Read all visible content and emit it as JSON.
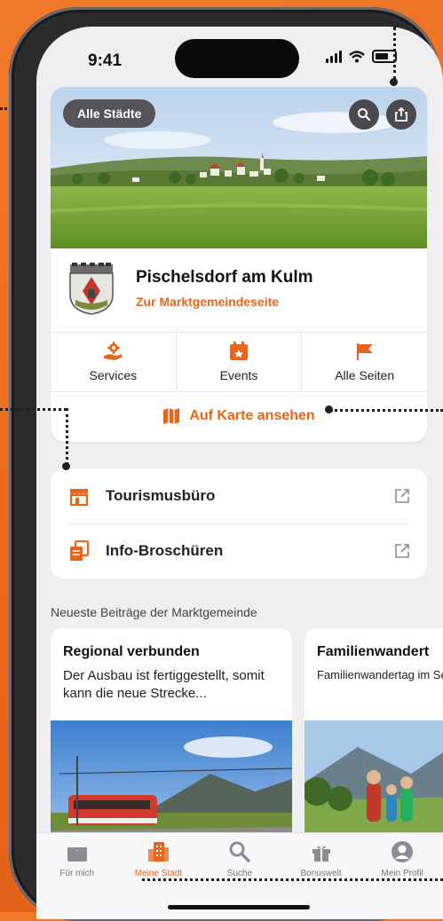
{
  "status_bar": {
    "time": "9:41"
  },
  "header": {
    "all_cities_label": "Alle Städte"
  },
  "town": {
    "name": "Pischelsdorf am Kulm",
    "link_label": "Zur Marktgemeindeseite"
  },
  "quick_actions": [
    {
      "label": "Services",
      "icon": "gear-hand-icon"
    },
    {
      "label": "Events",
      "icon": "calendar-star-icon"
    },
    {
      "label": "Alle Seiten",
      "icon": "flag-icon"
    }
  ],
  "map_link": {
    "label": "Auf Karte ansehen",
    "icon": "map-icon"
  },
  "links": [
    {
      "label": "Tourismusbüro",
      "icon": "storefront-icon"
    },
    {
      "label": "Info-Broschüren",
      "icon": "documents-icon"
    }
  ],
  "posts_section": {
    "title": "Neueste Beiträge der Marktgemeinde"
  },
  "posts": [
    {
      "title": "Regional verbunden",
      "teaser": "Der Ausbau ist fertiggestellt, somit kann die neue Strecke..."
    },
    {
      "title": "Familienwandert",
      "teaser": "Familienwandertag im September! Anr"
    }
  ],
  "tabbar": [
    {
      "label": "Für mich",
      "icon": "gift-box-icon",
      "active": false
    },
    {
      "label": "Meine Stadt",
      "icon": "buildings-icon",
      "active": true
    },
    {
      "label": "Suche",
      "icon": "search-icon",
      "active": false
    },
    {
      "label": "Bonuswelt",
      "icon": "gift-icon",
      "active": false
    },
    {
      "label": "Mein Profil",
      "icon": "profile-icon",
      "active": false
    }
  ],
  "colors": {
    "accent": "#e8661c",
    "background": "#efeff2",
    "card": "#ffffff"
  }
}
